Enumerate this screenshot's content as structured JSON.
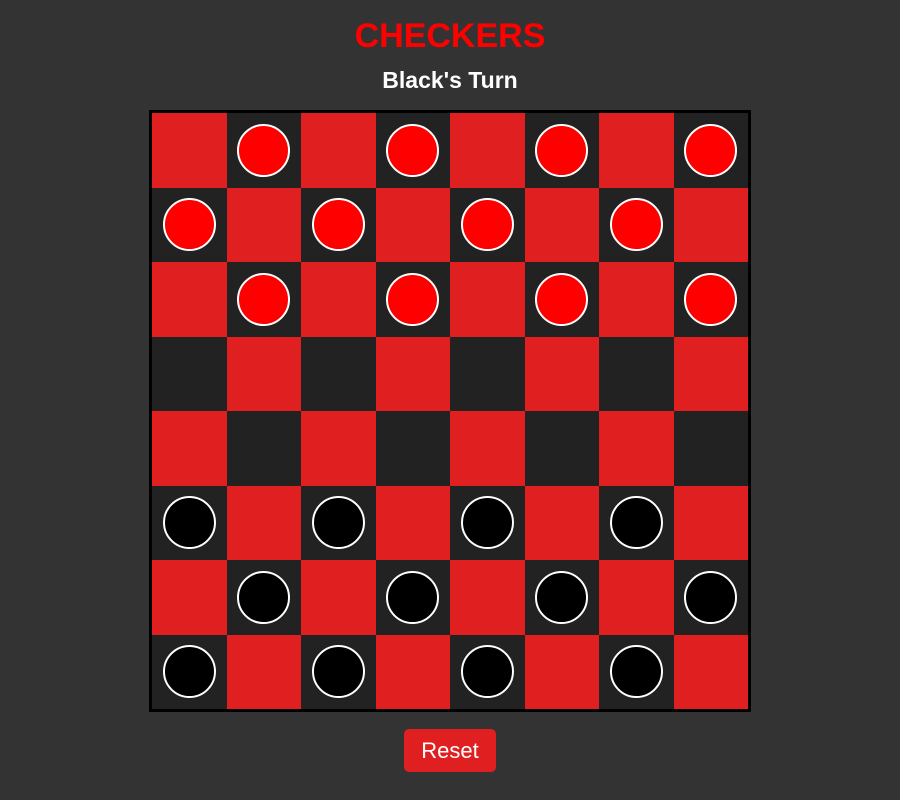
{
  "title": "CHECKERS",
  "status": "Black's Turn",
  "reset_label": "Reset",
  "colors": {
    "background": "#333333",
    "light_square": "#e02020",
    "dark_square": "#222222",
    "red_piece": "#ff0000",
    "black_piece": "#000000",
    "piece_border": "#ffffff",
    "title": "#ff0000"
  },
  "board": {
    "size": 8,
    "rows": [
      "-r-r-r-r",
      "r-r-r-r-",
      "-r-r-r-r",
      "--------",
      "--------",
      "b-b-b-b-",
      "-b-b-b-b",
      "b-b-b-b-"
    ]
  }
}
